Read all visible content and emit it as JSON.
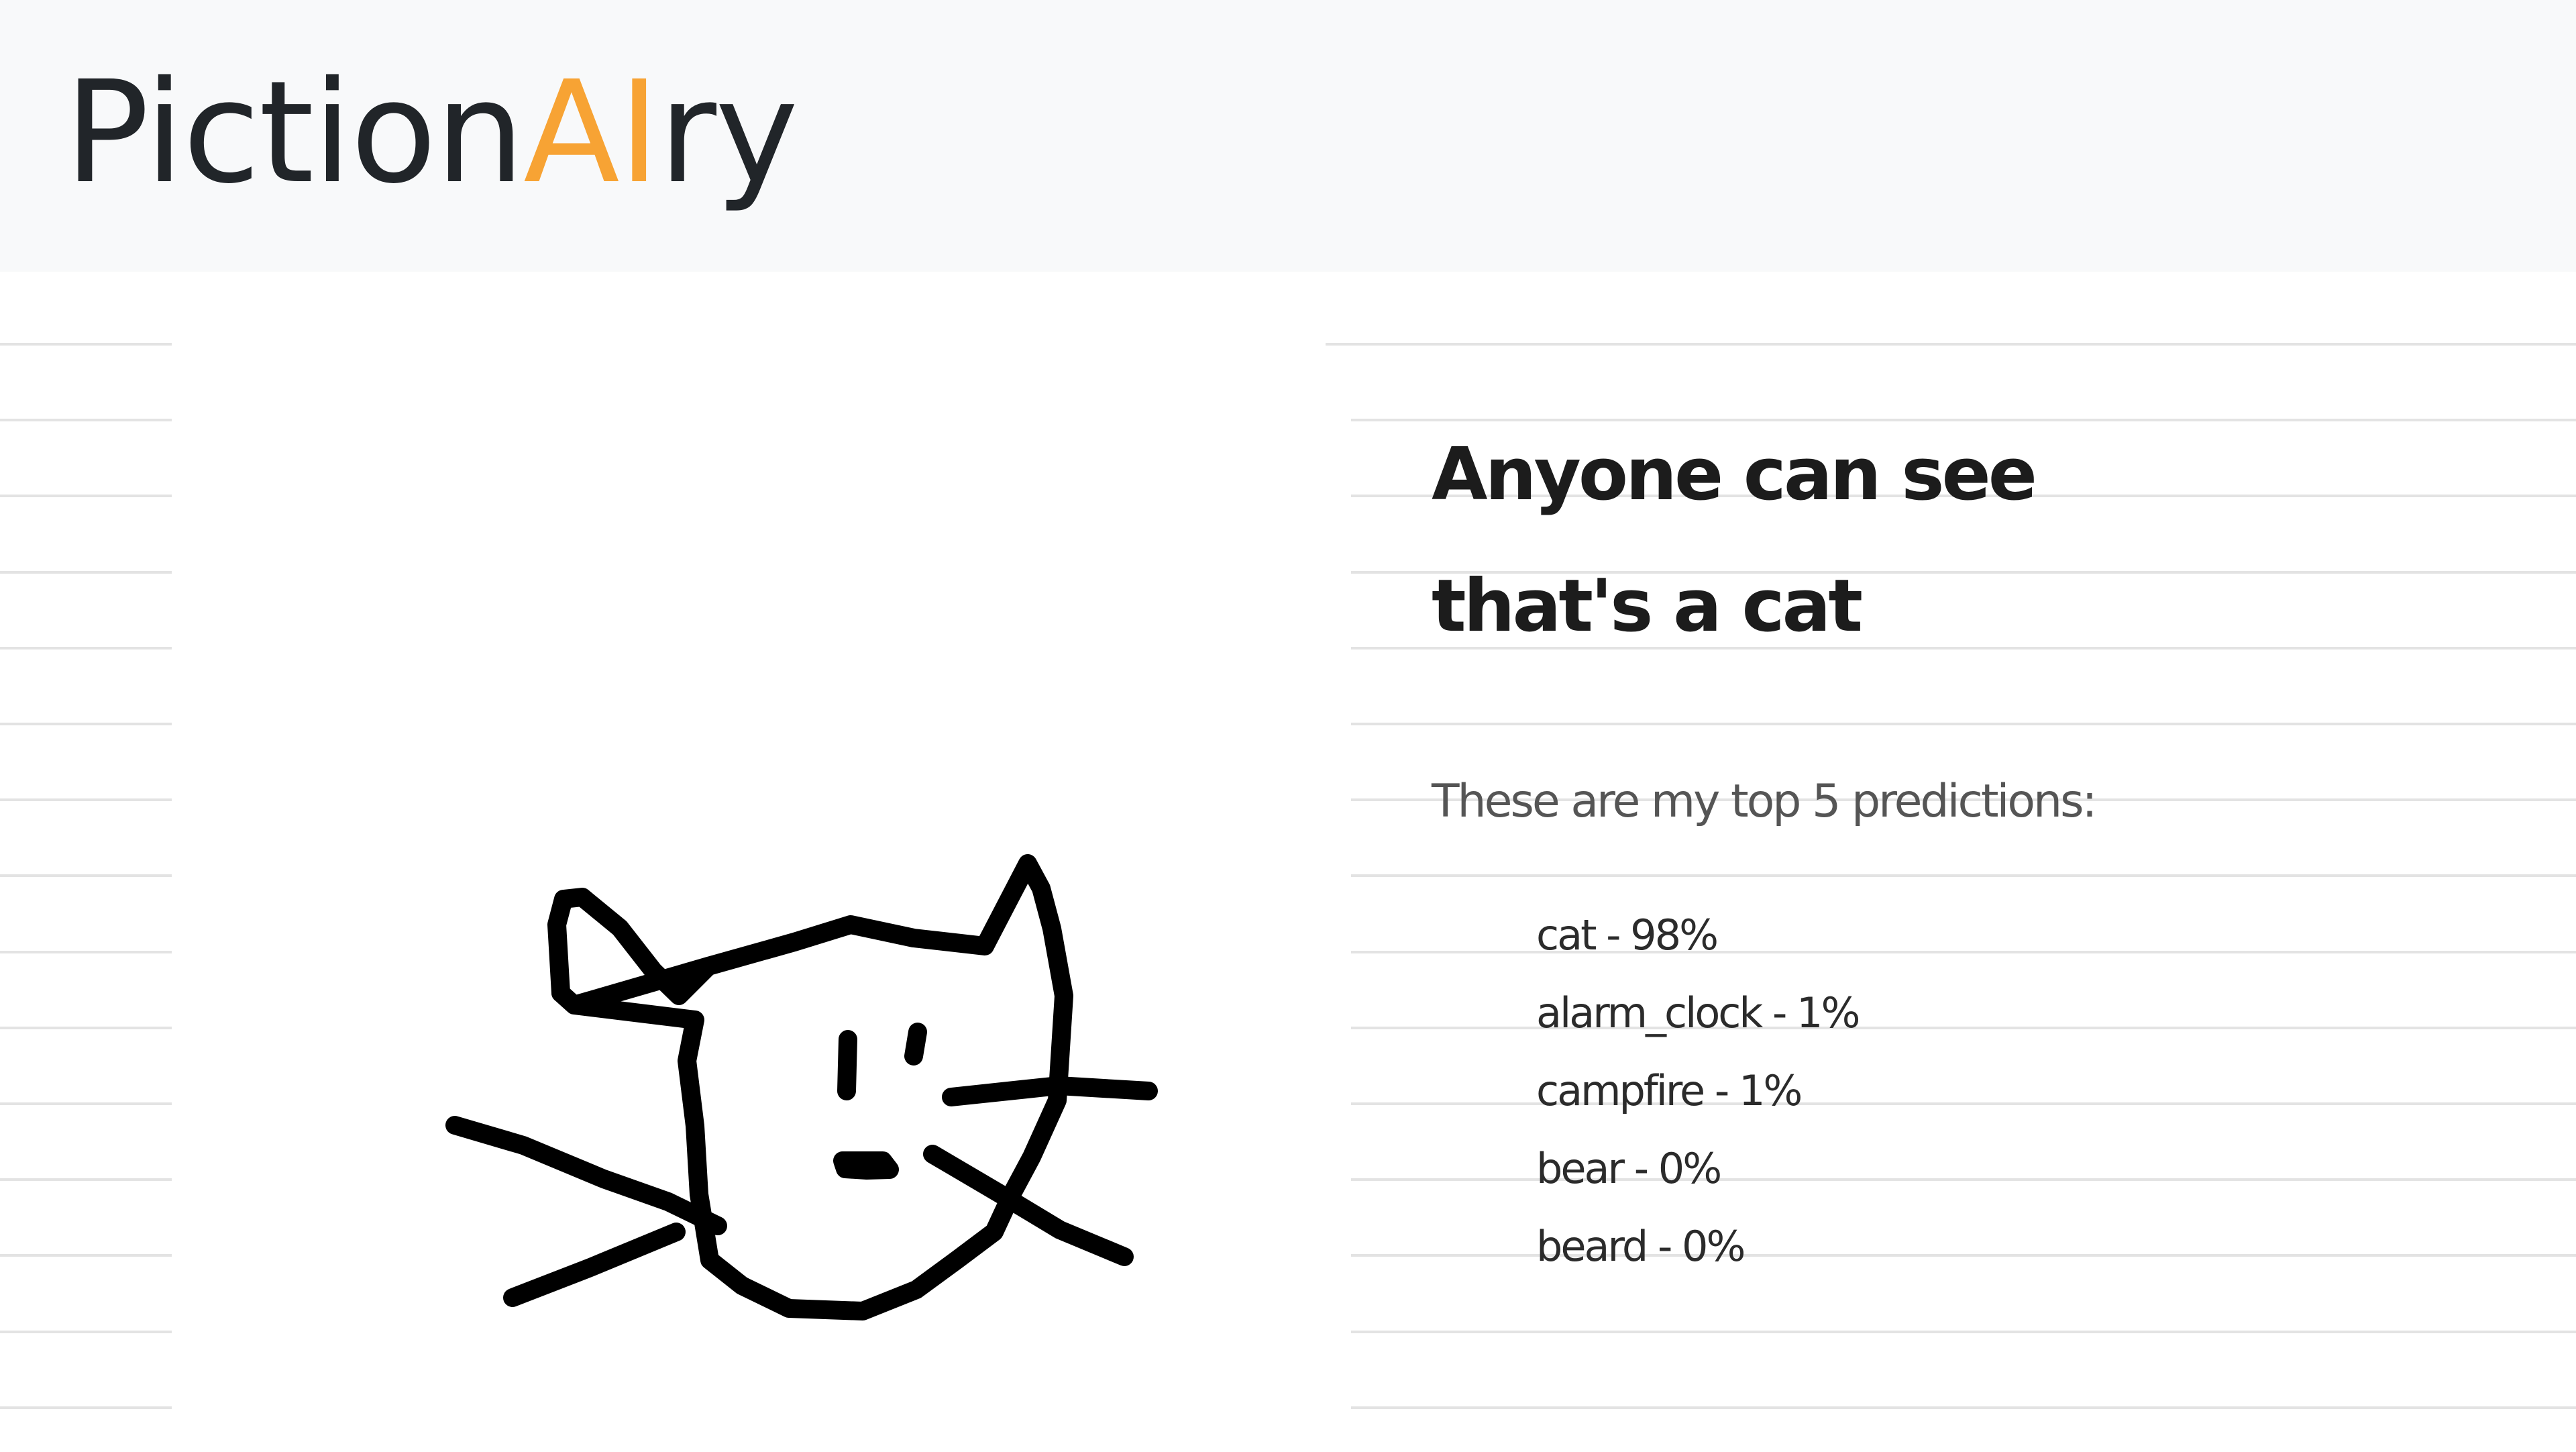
{
  "header": {
    "logo": {
      "prefix": "Piction",
      "highlight": "AI",
      "suffix": "ry",
      "highlight_color": "#f7a334"
    }
  },
  "canvas": {
    "drawing": "cat sketch"
  },
  "result": {
    "title": "Anyone can see that's a cat",
    "intro": "These are my top 5 predictions:",
    "predictions": [
      "cat - 98%",
      "alarm_clock - 1%",
      "campfire - 1%",
      "bear - 0%",
      "beard - 0%"
    ]
  }
}
